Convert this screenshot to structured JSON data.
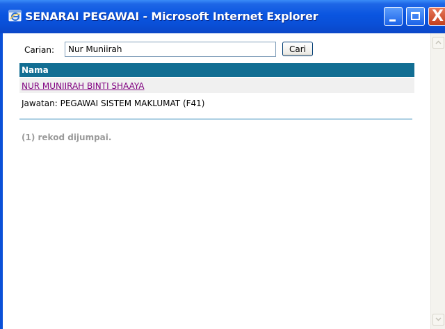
{
  "window": {
    "title": "SENARAI PEGAWAI - Microsoft Internet Explorer",
    "minimize_label": "",
    "maximize_label": "",
    "close_label": "X"
  },
  "search": {
    "label": "Carian:",
    "value": "Nur Muniirah",
    "button_label": "Cari"
  },
  "table": {
    "column_header": "Nama",
    "results": [
      {
        "name": "NUR MUNIIRAH BINTI SHAAYA",
        "jawatan": "Jawatan: PEGAWAI SISTEM MAKLUMAT (F41)"
      }
    ]
  },
  "status": {
    "record_count": "(1) rekod dijumpai."
  },
  "colors": {
    "titlebar": "#0a50d8",
    "table_header": "#126e93",
    "link_visited": "#800080",
    "divider": "#1a7ab0",
    "muted_text": "#9a9a9a"
  },
  "icons": {
    "app_icon": "internet-explorer-icon",
    "minimize": "minimize-icon",
    "maximize": "maximize-icon",
    "close": "close-icon",
    "scroll_up": "chevron-up-icon",
    "scroll_down": "chevron-down-icon"
  }
}
